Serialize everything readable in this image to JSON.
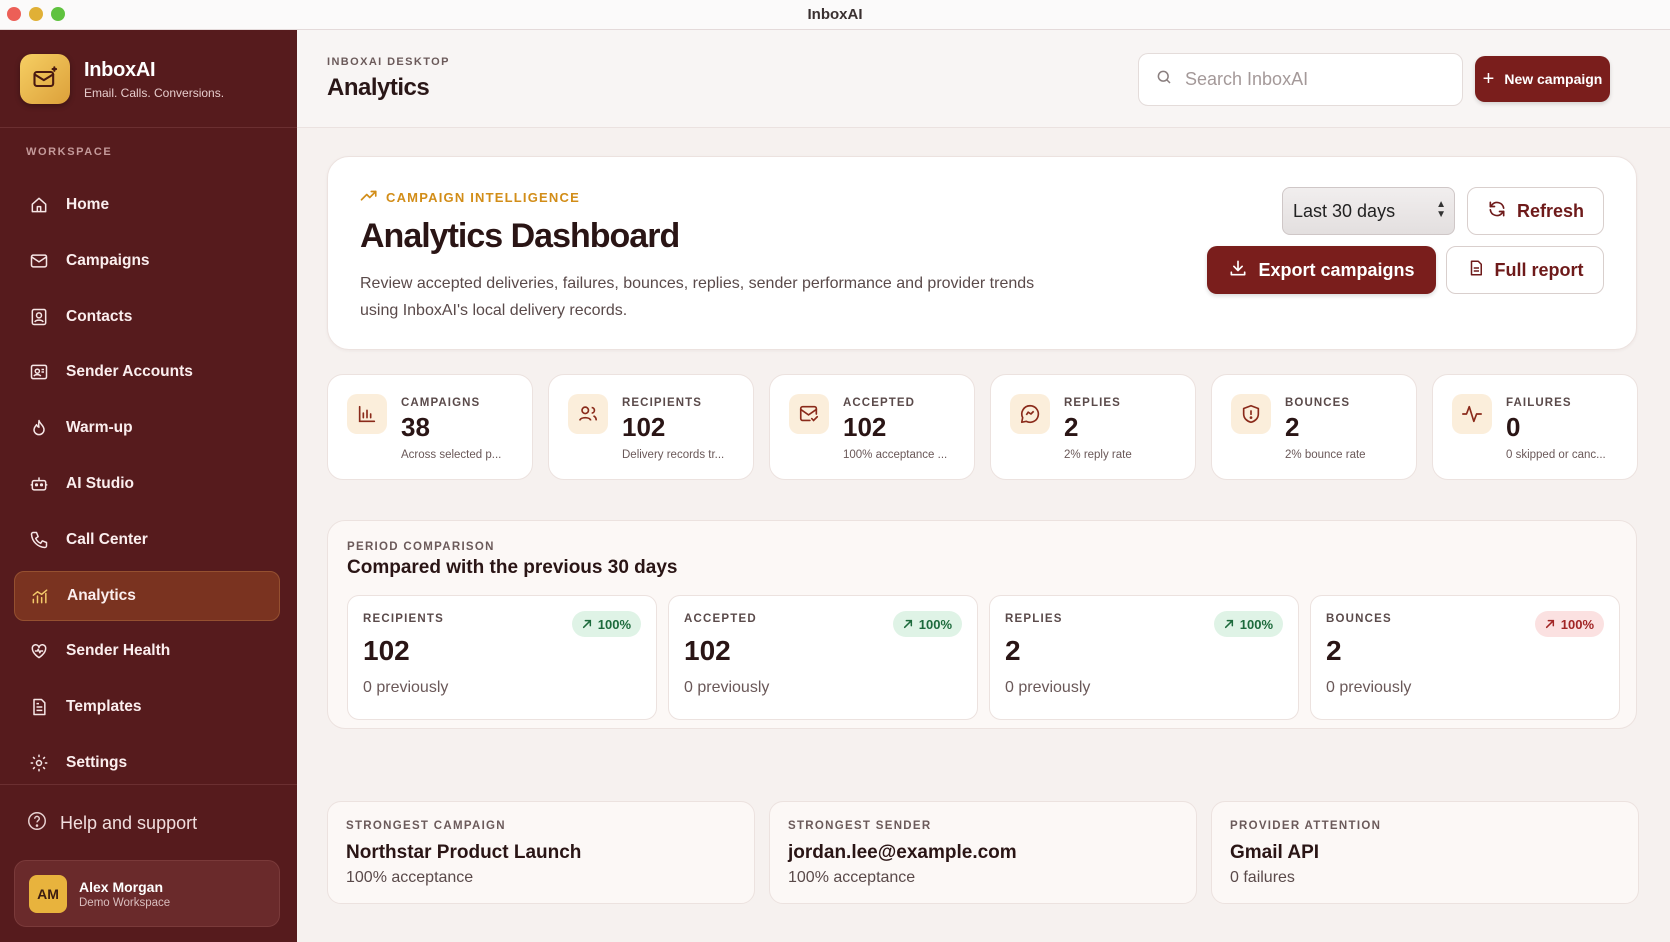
{
  "window": {
    "title": "InboxAI"
  },
  "brand": {
    "name": "InboxAI",
    "tagline": "Email. Calls. Conversions."
  },
  "sidebar": {
    "section_label": "WORKSPACE",
    "items": [
      {
        "label": "Home",
        "icon": "home-icon"
      },
      {
        "label": "Campaigns",
        "icon": "mail-icon"
      },
      {
        "label": "Contacts",
        "icon": "contact-card-icon"
      },
      {
        "label": "Sender Accounts",
        "icon": "sender-account-icon"
      },
      {
        "label": "Warm-up",
        "icon": "flame-icon"
      },
      {
        "label": "AI Studio",
        "icon": "robot-icon"
      },
      {
        "label": "Call Center",
        "icon": "phone-icon"
      },
      {
        "label": "Analytics",
        "icon": "chart-icon",
        "active": true
      },
      {
        "label": "Sender Health",
        "icon": "heart-pulse-icon"
      },
      {
        "label": "Templates",
        "icon": "document-icon"
      },
      {
        "label": "Settings",
        "icon": "gear-icon"
      }
    ],
    "help_label": "Help and support",
    "user": {
      "initials": "AM",
      "name": "Alex Morgan",
      "workspace": "Demo Workspace"
    }
  },
  "header": {
    "eyebrow": "INBOXAI DESKTOP",
    "title": "Analytics",
    "search_placeholder": "Search InboxAI",
    "new_campaign_label": "New campaign"
  },
  "hero": {
    "eyebrow": "CAMPAIGN INTELLIGENCE",
    "title": "Analytics Dashboard",
    "description": "Review accepted deliveries, failures, bounces, replies, sender performance and provider trends using InboxAI's local delivery records.",
    "range_value": "Last 30 days",
    "refresh_label": "Refresh",
    "export_label": "Export campaigns",
    "report_label": "Full report"
  },
  "stats": [
    {
      "label": "CAMPAIGNS",
      "value": "38",
      "sub": "Across selected p...",
      "icon": "bar-chart-icon"
    },
    {
      "label": "RECIPIENTS",
      "value": "102",
      "sub": "Delivery records tr...",
      "icon": "users-icon"
    },
    {
      "label": "ACCEPTED",
      "value": "102",
      "sub": "100% acceptance ...",
      "icon": "mail-check-icon"
    },
    {
      "label": "REPLIES",
      "value": "2",
      "sub": "2% reply rate",
      "icon": "reply-bubble-icon"
    },
    {
      "label": "BOUNCES",
      "value": "2",
      "sub": "2% bounce rate",
      "icon": "shield-alert-icon"
    },
    {
      "label": "FAILURES",
      "value": "0",
      "sub": "0 skipped or canc...",
      "icon": "activity-icon"
    }
  ],
  "period": {
    "eyebrow": "PERIOD COMPARISON",
    "title": "Compared with the previous 30 days",
    "items": [
      {
        "label": "RECIPIENTS",
        "value": "102",
        "previous": "0 previously",
        "change": "100%",
        "tone": "positive"
      },
      {
        "label": "ACCEPTED",
        "value": "102",
        "previous": "0 previously",
        "change": "100%",
        "tone": "positive"
      },
      {
        "label": "REPLIES",
        "value": "2",
        "previous": "0 previously",
        "change": "100%",
        "tone": "positive"
      },
      {
        "label": "BOUNCES",
        "value": "2",
        "previous": "0 previously",
        "change": "100%",
        "tone": "negative"
      }
    ]
  },
  "highlights": [
    {
      "label": "STRONGEST CAMPAIGN",
      "value": "Northstar Product Launch",
      "sub": "100% acceptance"
    },
    {
      "label": "STRONGEST SENDER",
      "value": "jordan.lee@example.com",
      "sub": "100% acceptance"
    },
    {
      "label": "PROVIDER ATTENTION",
      "value": "Gmail API",
      "sub": "0 failures"
    }
  ],
  "colors": {
    "sidebar_bg": "#561b1d",
    "primary": "#7a1e1c",
    "accent": "#d28d18",
    "positive": "#1d6a3c",
    "negative": "#a12525"
  }
}
